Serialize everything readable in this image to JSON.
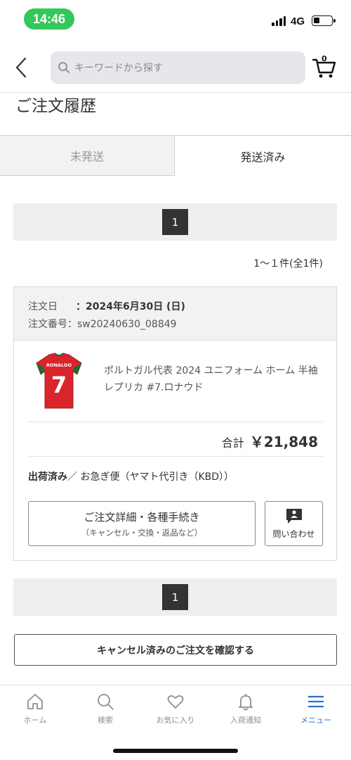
{
  "status_bar": {
    "time": "14:46",
    "network": "4G",
    "battery_level": 0.35
  },
  "header": {
    "back_icon": "chevron-left-icon",
    "search": {
      "placeholder": "キーワードから探す",
      "icon": "search-icon"
    },
    "cart": {
      "count": "0",
      "icon": "cart-icon"
    }
  },
  "page": {
    "title": "ご注文履歴"
  },
  "tabs": [
    {
      "label": "未発送",
      "active": false
    },
    {
      "label": "発送済み",
      "active": true
    }
  ],
  "pagination": {
    "current_page": "1"
  },
  "result_count": "1～１件(全1件)",
  "order": {
    "date_label": "注文日",
    "date_value": "：2024年6月30日 (日)",
    "number_text": "注文番号：sw20240630_08849",
    "product_name": "ポルトガル代表 2024 ユニフォーム ホーム 半袖 レプリカ #7.ロナウド",
    "product_image": {
      "name_print": "RONALDO",
      "number_print": "7",
      "color": "#d8252b"
    },
    "total_label": "合計",
    "total_value": "￥21,848",
    "ship_status": "出荷済み",
    "ship_method": "／ お急ぎ便（ヤマト代引き（KBD））",
    "detail_button": {
      "main": "ご注文詳細・各種手続き",
      "sub": "（キャンセル・交換・返品など）"
    },
    "inquiry_button": {
      "label": "問い合わせ",
      "icon": "chat-icon"
    }
  },
  "cancelled_button": "キャンセル済みのご注文を確認する",
  "bottom_nav": [
    {
      "label": "ホーム",
      "icon": "home-icon",
      "active": false
    },
    {
      "label": "検索",
      "icon": "search-icon",
      "active": false
    },
    {
      "label": "お気に入り",
      "icon": "heart-icon",
      "active": false
    },
    {
      "label": "入荷通知",
      "icon": "bell-icon",
      "active": false
    },
    {
      "label": "メニュー",
      "icon": "menu-icon",
      "active": true
    }
  ],
  "colors": {
    "accent": "#2a72c9",
    "status_pill": "#34c759",
    "pager_bg": "#333333"
  }
}
